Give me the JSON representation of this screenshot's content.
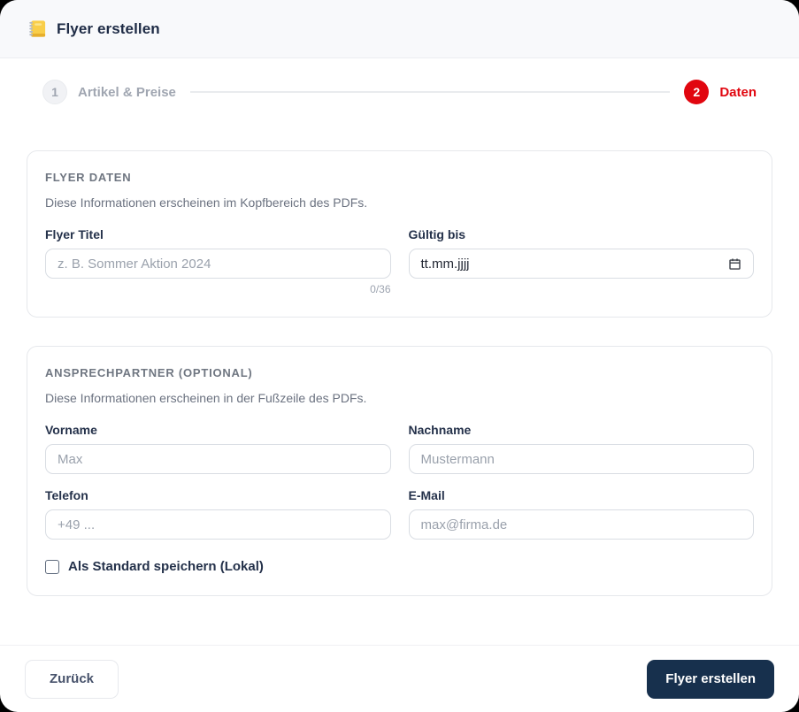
{
  "window": {
    "title": "Flyer erstellen"
  },
  "stepper": {
    "steps": [
      {
        "number": "1",
        "label": "Artikel & Preise",
        "state": "inactive"
      },
      {
        "number": "2",
        "label": "Daten",
        "state": "active"
      }
    ]
  },
  "flyer_section": {
    "title": "FLYER DATEN",
    "subtitle": "Diese Informationen erscheinen im Kopfbereich des PDFs.",
    "fields": {
      "title": {
        "label": "Flyer Titel",
        "placeholder": "z. B. Sommer Aktion 2024",
        "value": "",
        "counter": "0/36"
      },
      "valid_until": {
        "label": "Gültig bis",
        "value": "tt.mm.jjjj"
      }
    }
  },
  "contact_section": {
    "title": "ANSPRECHPARTNER (OPTIONAL)",
    "subtitle": "Diese Informationen erscheinen in der Fußzeile des PDFs.",
    "fields": {
      "first_name": {
        "label": "Vorname",
        "placeholder": "Max",
        "value": ""
      },
      "last_name": {
        "label": "Nachname",
        "placeholder": "Mustermann",
        "value": ""
      },
      "phone": {
        "label": "Telefon",
        "placeholder": "+49 ...",
        "value": ""
      },
      "email": {
        "label": "E-Mail",
        "placeholder": "max@firma.de",
        "value": ""
      }
    },
    "save_default_checkbox": {
      "label": "Als Standard speichern (Lokal)",
      "checked": false
    }
  },
  "footer": {
    "back_label": "Zurück",
    "submit_label": "Flyer erstellen"
  },
  "colors": {
    "accent_red": "#e1060f",
    "navy_text": "#25324b",
    "submit_navy": "#17304d",
    "header_bg": "#f8f9fb"
  },
  "icons": {
    "header": "ledger-icon",
    "date": "calendar-icon"
  }
}
